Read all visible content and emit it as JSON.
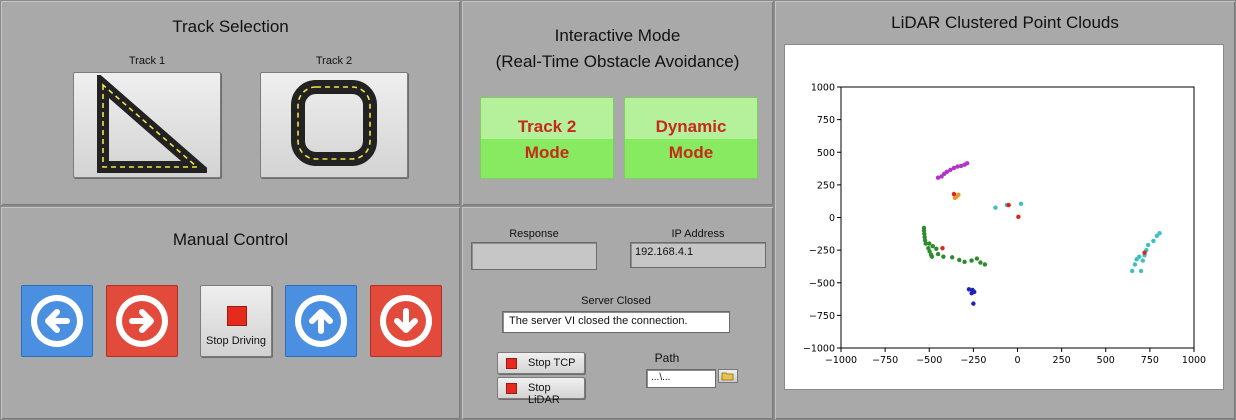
{
  "track_selection": {
    "title": "Track Selection",
    "track1_label": "Track 1",
    "track2_label": "Track 2",
    "track1_icon": "triangle-track-icon",
    "track2_icon": "rounded-square-track-icon"
  },
  "interactive": {
    "title_line1": "Interactive Mode",
    "title_line2": "(Real-Time Obstacle Avoidance)",
    "track2_line1": "Track 2",
    "track2_line2": "Mode",
    "dynamic_line1": "Dynamic",
    "dynamic_line2": "Mode"
  },
  "manual": {
    "title": "Manual Control",
    "stop_label": "Stop Driving",
    "left_icon": "arrow-left-icon",
    "right_icon": "arrow-right-icon",
    "up_icon": "arrow-up-icon",
    "down_icon": "arrow-down-icon"
  },
  "tcp": {
    "response_label": "Response",
    "response_value": "",
    "ip_label": "IP Address",
    "ip_value": "192.168.4.1",
    "server_label": "Server Closed",
    "server_value": "The server VI closed the connection.",
    "stop_tcp": "Stop TCP",
    "stop_lidar": "Stop LiDAR",
    "path_label": "Path",
    "path_value": "...\\...",
    "browse_icon": "folder-open-icon"
  },
  "colors": {
    "panel": "#a9a9a9",
    "mode_green": "#88ea60",
    "mode_text": "#c72a1c",
    "blue_btn": "#4a8fe0",
    "red_btn": "#e24a3c"
  },
  "chart_data": {
    "type": "scatter",
    "title": "LiDAR Clustered Point Clouds",
    "xlim": [
      -1000,
      1000
    ],
    "ylim": [
      -1000,
      1000
    ],
    "xticks": [
      -1000,
      -750,
      -500,
      -250,
      0,
      250,
      500,
      750,
      1000
    ],
    "yticks": [
      -1000,
      -750,
      -500,
      -250,
      0,
      250,
      500,
      750,
      1000
    ],
    "grid": false,
    "series": [
      {
        "color": "#b233c9",
        "points": [
          [
            -450,
            305
          ],
          [
            -430,
            315
          ],
          [
            -415,
            335
          ],
          [
            -400,
            350
          ],
          [
            -380,
            365
          ],
          [
            -360,
            380
          ],
          [
            -340,
            390
          ],
          [
            -320,
            395
          ],
          [
            -300,
            405
          ],
          [
            -285,
            415
          ]
        ]
      },
      {
        "color": "#e39a2a",
        "points": [
          [
            -355,
            150
          ],
          [
            -345,
            160
          ],
          [
            -335,
            175
          ]
        ]
      },
      {
        "color": "#2e8b2e",
        "points": [
          [
            -530,
            -80
          ],
          [
            -530,
            -100
          ],
          [
            -528,
            -125
          ],
          [
            -526,
            -150
          ],
          [
            -524,
            -175
          ],
          [
            -520,
            -200
          ],
          [
            -505,
            -235
          ],
          [
            -498,
            -260
          ],
          [
            -490,
            -285
          ],
          [
            -485,
            -300
          ],
          [
            -460,
            -240
          ],
          [
            -450,
            -280
          ],
          [
            -420,
            -300
          ],
          [
            -370,
            -305
          ],
          [
            -330,
            -325
          ],
          [
            -300,
            -340
          ],
          [
            -260,
            -330
          ],
          [
            -230,
            -315
          ],
          [
            -210,
            -345
          ],
          [
            -185,
            -360
          ],
          [
            -500,
            -200
          ],
          [
            -480,
            -220
          ]
        ]
      },
      {
        "color": "#1f22b8",
        "points": [
          [
            -275,
            -550
          ],
          [
            -255,
            -555
          ],
          [
            -260,
            -580
          ],
          [
            -245,
            -570
          ],
          [
            -250,
            -660
          ]
        ]
      },
      {
        "color": "#3fbfbf",
        "points": [
          [
            -125,
            75
          ],
          [
            -60,
            95
          ],
          [
            20,
            105
          ],
          [
            650,
            -410
          ],
          [
            665,
            -360
          ],
          [
            675,
            -320
          ],
          [
            690,
            -300
          ],
          [
            700,
            -410
          ],
          [
            710,
            -330
          ],
          [
            720,
            -290
          ],
          [
            730,
            -250
          ],
          [
            740,
            -210
          ],
          [
            770,
            -180
          ],
          [
            790,
            -140
          ],
          [
            805,
            -120
          ]
        ]
      },
      {
        "color": "#e0221c",
        "points": [
          [
            -425,
            -235
          ],
          [
            -360,
            180
          ],
          [
            -50,
            95
          ],
          [
            5,
            5
          ],
          [
            720,
            -270
          ]
        ]
      }
    ]
  }
}
